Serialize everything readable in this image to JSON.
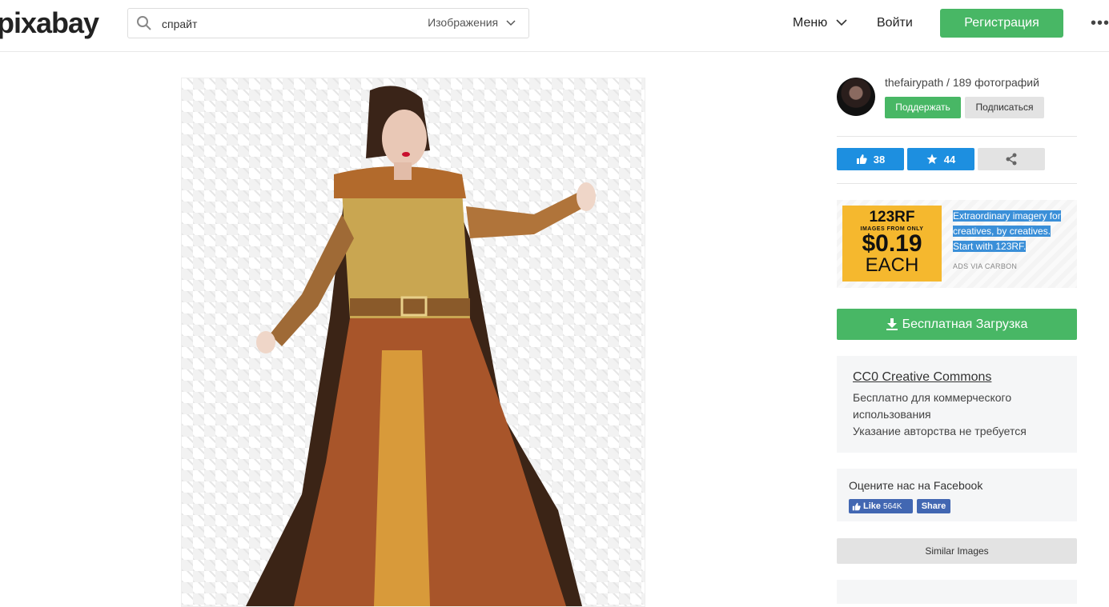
{
  "header": {
    "logo": "pixabay",
    "search_value": "спрайт",
    "search_type": "Изображения",
    "menu_label": "Меню",
    "login_label": "Войти",
    "register_label": "Регистрация",
    "more_label": "•••"
  },
  "author": {
    "name_line": "thefairypath / 189 фотографий",
    "support_label": "Поддержать",
    "subscribe_label": "Подписаться"
  },
  "stats": {
    "likes": "38",
    "favorites": "44"
  },
  "ad": {
    "brand": "123RF",
    "from_text": "IMAGES FROM ONLY",
    "price": "$0.19",
    "each": "EACH",
    "text": "Extraordinary imagery for creatives, by creatives. Start with 123RF.",
    "via": "ADS VIA CARBON"
  },
  "download_label": "Бесплатная Загрузка",
  "license": {
    "title": "CC0 Creative Commons",
    "line1": "Бесплатно для коммерческого использования",
    "line2": "Указание авторства не требуется"
  },
  "facebook": {
    "label": "Оцените нас на Facebook",
    "like": "Like",
    "count": "564K",
    "share": "Share"
  },
  "similar_label": "Similar Images",
  "colors": {
    "green": "#48b765",
    "blue": "#1d8fe0",
    "facebook": "#4267b2",
    "ad_yellow": "#f5b82e"
  }
}
